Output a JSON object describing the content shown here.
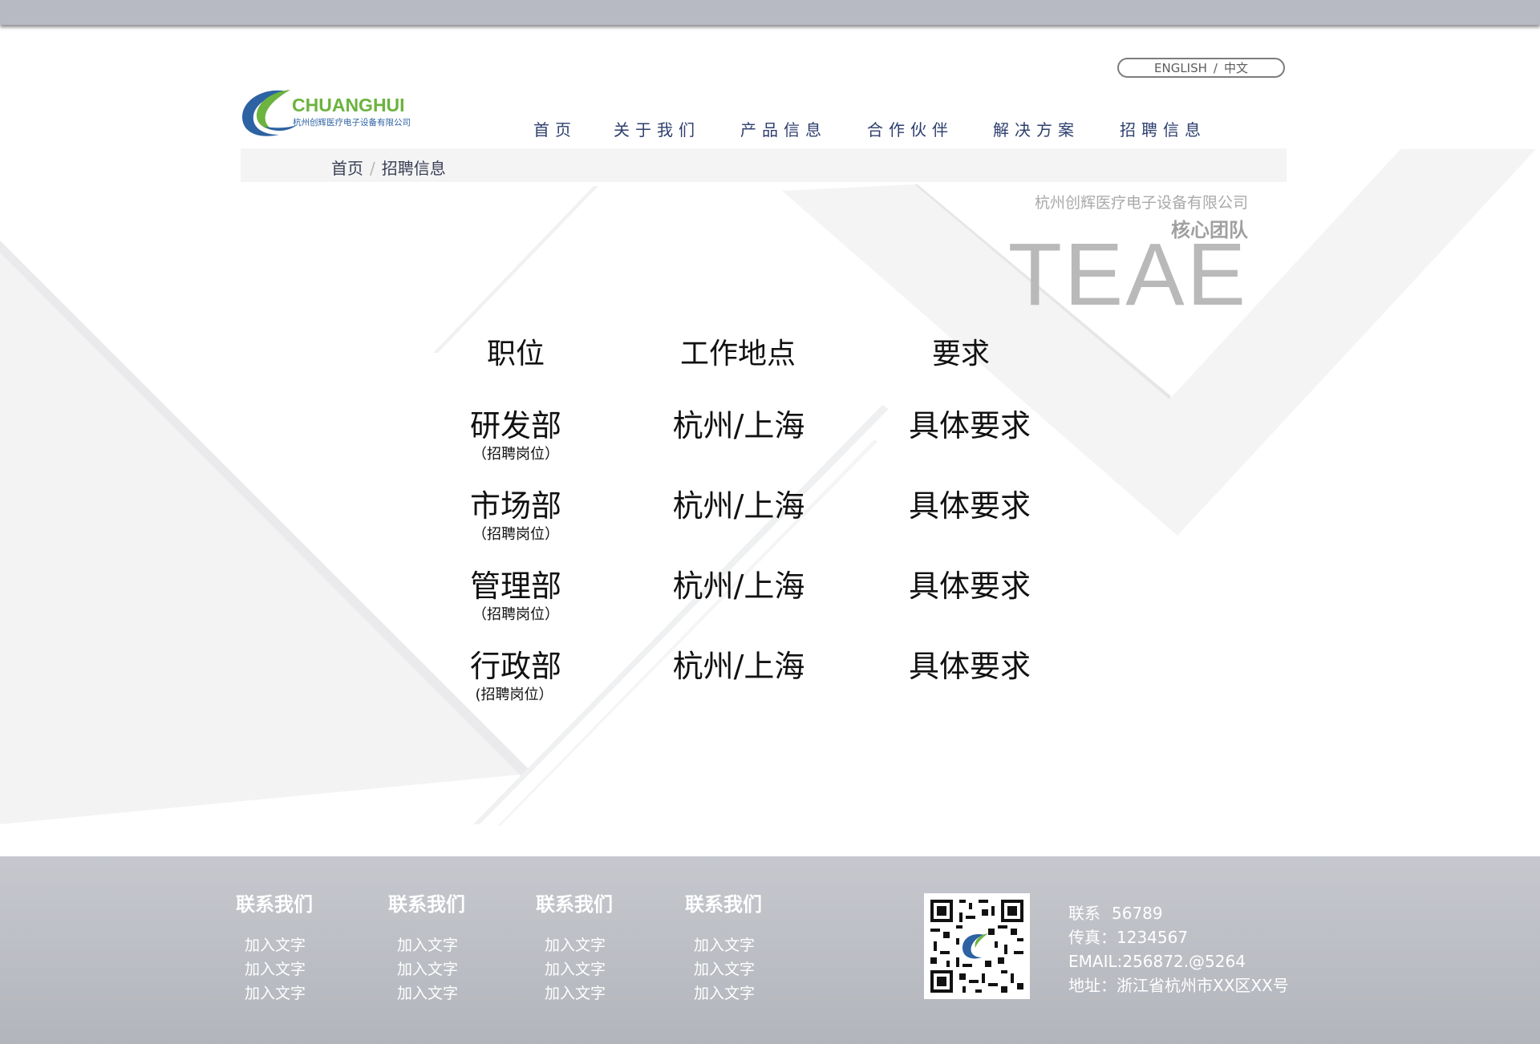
{
  "language_switch": {
    "english": "ENGLISH",
    "separator": "/",
    "chinese": "中文"
  },
  "logo": {
    "name": "CHUANGHUI",
    "subtitle": "杭州创辉医疗电子设备有限公司",
    "colors": {
      "green": "#6cb33f",
      "blue": "#2d62a3"
    }
  },
  "nav": {
    "items": [
      {
        "label": "首页"
      },
      {
        "label": "关于我们"
      },
      {
        "label": "产品信息"
      },
      {
        "label": "合作伙伴"
      },
      {
        "label": "解决方案"
      },
      {
        "label": "招聘信息"
      }
    ]
  },
  "breadcrumb": {
    "home": "首页",
    "separator": "/",
    "current": "招聘信息"
  },
  "hero": {
    "company": "杭州创辉医疗电子设备有限公司",
    "section": "核心团队",
    "big_word": "TEAE"
  },
  "table": {
    "headers": [
      "职位",
      "工作地点",
      "要求"
    ],
    "rows": [
      {
        "department": "研发部",
        "sub": "（招聘岗位）",
        "location": "杭州/上海",
        "requirement": "具体要求"
      },
      {
        "department": "市场部",
        "sub": "（招聘岗位）",
        "location": "杭州/上海",
        "requirement": "具体要求"
      },
      {
        "department": "管理部",
        "sub": "（招聘岗位）",
        "location": "杭州/上海",
        "requirement": "具体要求"
      },
      {
        "department": "行政部",
        "sub": "(招聘岗位）",
        "location": "杭州/上海",
        "requirement": "具体要求"
      }
    ]
  },
  "footer": {
    "columns": [
      {
        "title": "联系我们",
        "links": [
          "加入文字",
          "加入文字",
          "加入文字"
        ]
      },
      {
        "title": "联系我们",
        "links": [
          "加入文字",
          "加入文字",
          "加入文字"
        ]
      },
      {
        "title": "联系我们",
        "links": [
          "加入文字",
          "加入文字",
          "加入文字"
        ]
      },
      {
        "title": "联系我们",
        "links": [
          "加入文字",
          "加入文字",
          "加入文字"
        ]
      }
    ],
    "contact": {
      "phone_label": "联系",
      "phone": "56789",
      "fax": "传真：1234567",
      "email": "EMAIL:256872.@5264",
      "address": "地址：浙江省杭州市XX区XX号"
    }
  }
}
